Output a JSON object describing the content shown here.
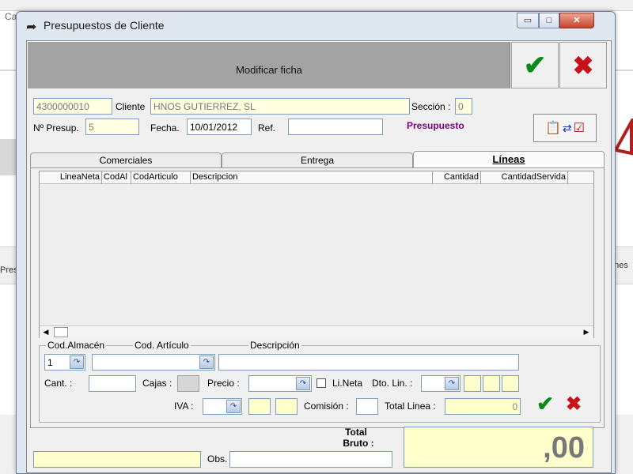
{
  "background": {
    "title_fragment": "Ca",
    "left_fragment": "Pres",
    "right_fragment": "ones"
  },
  "window": {
    "title": "Presupuestos de Cliente",
    "minimize": "▭",
    "maximize": "□",
    "close": "✕"
  },
  "header": {
    "mode_text": "Modificar ficha",
    "accept_icon": "check-icon",
    "cancel_icon": "cross-icon"
  },
  "form": {
    "client_code": "4300000010",
    "client_label": "Cliente",
    "client_name": "HNOS GUTIERREZ, SL",
    "section_label": "Sección :",
    "section_value": "0",
    "budget_no_label": "Nº Presup.",
    "budget_no": "5",
    "date_label": "Fecha.",
    "date": "10/01/2012",
    "ref_label": "Ref.",
    "ref_value": "",
    "status": "Presupuesto"
  },
  "tabs": [
    {
      "label": "Comerciales",
      "active": false
    },
    {
      "label": "Entrega",
      "active": false
    },
    {
      "label": "Líneas",
      "active": true
    }
  ],
  "grid": {
    "columns": [
      "LineaNeta",
      "CodAl",
      "CodArticulo",
      "Descripcion",
      "Cantidad",
      "CantidadServida"
    ],
    "rows": []
  },
  "line_editor": {
    "warehouse_label": "Cod.Almacén",
    "article_label": "Cod. Artículo",
    "description_label": "Descripción",
    "warehouse_value": "1",
    "article_value": "",
    "description_value": "",
    "qty_label": "Cant. :",
    "boxes_label": "Cajas :",
    "price_label": "Precio :",
    "net_line_label": "Li.Neta",
    "discount_label": "Dto. Lin. :",
    "vat_label": "IVA :",
    "commission_label": "Comisión :",
    "total_line_label": "Total Linea :",
    "total_line_value": "0"
  },
  "footer": {
    "obs_label": "Obs.",
    "obs_value": "",
    "total_label_1": "Total",
    "total_label_2": "Bruto  :",
    "total_value": ",00"
  },
  "colors": {
    "accent_check": "#0a8a1a",
    "accent_cross": "#c8121b",
    "status_purple": "#800080",
    "readonly_yellow": "#ffffcc"
  }
}
